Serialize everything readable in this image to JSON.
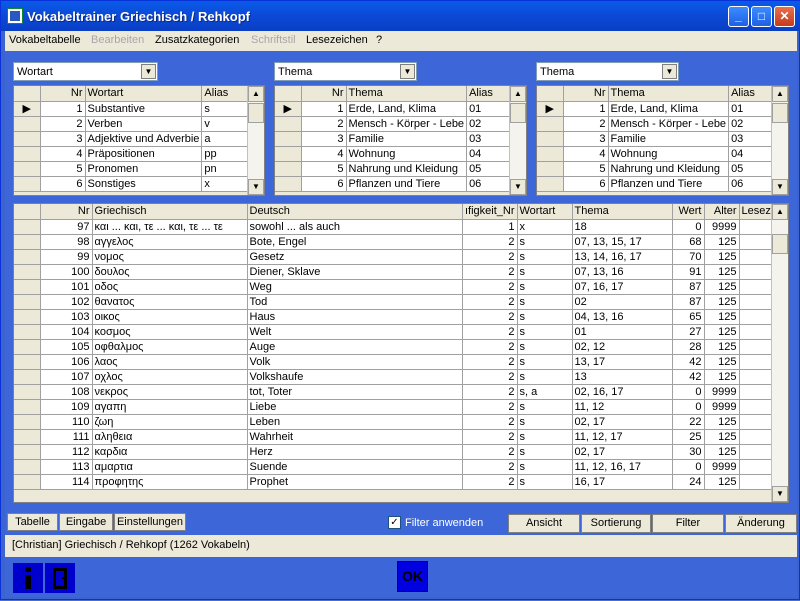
{
  "window": {
    "title": "Vokabeltrainer Griechisch / Rehkopf"
  },
  "menu": [
    "Vokabeltabelle",
    "Bearbeiten",
    "Zusatzkategorien",
    "Schriftstil",
    "Lesezeichen",
    "?"
  ],
  "combos": [
    "Wortart",
    "Thema",
    "Thema"
  ],
  "wortart": {
    "headers": [
      "Nr",
      "Wortart",
      "Alias"
    ],
    "rows": [
      [
        "1",
        "Substantive",
        "s"
      ],
      [
        "2",
        "Verben",
        "v"
      ],
      [
        "3",
        "Adjektive und Adverbie",
        "a"
      ],
      [
        "4",
        "Präpositionen",
        "pp"
      ],
      [
        "5",
        "Pronomen",
        "pn"
      ],
      [
        "6",
        "Sonstiges",
        "x"
      ]
    ]
  },
  "thema1": {
    "headers": [
      "Nr",
      "Thema",
      "Alias"
    ],
    "rows": [
      [
        "1",
        "Erde, Land, Klima",
        "01"
      ],
      [
        "2",
        "Mensch - Körper - Lebe",
        "02"
      ],
      [
        "3",
        "Familie",
        "03"
      ],
      [
        "4",
        "Wohnung",
        "04"
      ],
      [
        "5",
        "Nahrung und Kleidung",
        "05"
      ],
      [
        "6",
        "Pflanzen und Tiere",
        "06"
      ]
    ]
  },
  "thema2": {
    "headers": [
      "Nr",
      "Thema",
      "Alias"
    ],
    "rows": [
      [
        "1",
        "Erde, Land, Klima",
        "01"
      ],
      [
        "2",
        "Mensch - Körper - Lebe",
        "02"
      ],
      [
        "3",
        "Familie",
        "03"
      ],
      [
        "4",
        "Wohnung",
        "04"
      ],
      [
        "5",
        "Nahrung und Kleidung",
        "05"
      ],
      [
        "6",
        "Pflanzen und Tiere",
        "06"
      ]
    ]
  },
  "main": {
    "headers": [
      "Nr",
      "Griechisch",
      "Deutsch",
      "ıfigkeit_Nr",
      "Wortart",
      "Thema",
      "Wert",
      "Alter",
      "Lesez"
    ],
    "rows": [
      [
        "97",
        "και ... και, τε ... και, τε ... τε",
        "sowohl ... als auch",
        "1",
        "x",
        "18",
        "0",
        "9999",
        ""
      ],
      [
        "98",
        "αγγελος",
        "Bote, Engel",
        "2",
        "s",
        "07, 13, 15, 17",
        "68",
        "125",
        ""
      ],
      [
        "99",
        "νομος",
        "Gesetz",
        "2",
        "s",
        "13, 14, 16, 17",
        "70",
        "125",
        ""
      ],
      [
        "100",
        "δουλος",
        "Diener, Sklave",
        "2",
        "s",
        "07, 13, 16",
        "91",
        "125",
        ""
      ],
      [
        "101",
        "οδος",
        "Weg",
        "2",
        "s",
        "07, 16, 17",
        "87",
        "125",
        ""
      ],
      [
        "102",
        "θανατος",
        "Tod",
        "2",
        "s",
        "02",
        "87",
        "125",
        ""
      ],
      [
        "103",
        "οικος",
        "Haus",
        "2",
        "s",
        "04, 13, 16",
        "65",
        "125",
        ""
      ],
      [
        "104",
        "κοσμος",
        "Welt",
        "2",
        "s",
        "01",
        "27",
        "125",
        ""
      ],
      [
        "105",
        "οφθαλμος",
        "Auge",
        "2",
        "s",
        "02, 12",
        "28",
        "125",
        ""
      ],
      [
        "106",
        "λαος",
        "Volk",
        "2",
        "s",
        "13, 17",
        "42",
        "125",
        ""
      ],
      [
        "107",
        "οχλος",
        "Volkshaufe",
        "2",
        "s",
        "13",
        "42",
        "125",
        ""
      ],
      [
        "108",
        "νεκρος",
        "tot, Toter",
        "2",
        "s, a",
        "02, 16, 17",
        "0",
        "9999",
        ""
      ],
      [
        "109",
        "αγαπη",
        "Liebe",
        "2",
        "s",
        "11, 12",
        "0",
        "9999",
        ""
      ],
      [
        "110",
        "ζωη",
        "Leben",
        "2",
        "s",
        "02, 17",
        "22",
        "125",
        ""
      ],
      [
        "111",
        "αληθεια",
        "Wahrheit",
        "2",
        "s",
        "11, 12, 17",
        "25",
        "125",
        ""
      ],
      [
        "112",
        "καρδια",
        "Herz",
        "2",
        "s",
        "02, 17",
        "30",
        "125",
        ""
      ],
      [
        "113",
        "αμαρτια",
        "Suende",
        "2",
        "s",
        "11, 12, 16, 17",
        "0",
        "9999",
        ""
      ],
      [
        "114",
        "προφητης",
        "Prophet",
        "2",
        "s",
        "16, 17",
        "24",
        "125",
        ""
      ]
    ]
  },
  "tabs": [
    "Tabelle",
    "Eingabe",
    "Einstellungen"
  ],
  "filter_label": "Filter anwenden",
  "buttons": [
    "Ansicht",
    "Sortierung",
    "Filter",
    "Änderung"
  ],
  "status": "[Christian]  Griechisch / Rehkopf  (1262 Vokabeln)",
  "ok_label": "OK"
}
